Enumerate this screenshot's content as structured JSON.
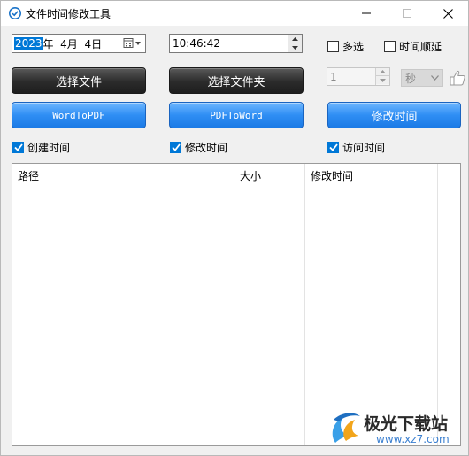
{
  "window": {
    "title": "文件时间修改工具"
  },
  "date": {
    "year": "2023",
    "rest": "年  4月  4日"
  },
  "time": {
    "value": "10:46:42"
  },
  "options": {
    "multi_select_label": "多选",
    "time_order_label": "时间顺延",
    "step_value": "1",
    "unit_value": "秒"
  },
  "buttons": {
    "select_file": "选择文件",
    "select_folder": "选择文件夹",
    "word_to_pdf": "WordToPDF",
    "pdf_to_word": "PDFToWord",
    "modify_time": "修改时间"
  },
  "checks": {
    "created_time": "创建时间",
    "modified_time": "修改时间",
    "accessed_time": "访问时间"
  },
  "list": {
    "columns": [
      "路径",
      "大小",
      "修改时间"
    ],
    "rows": []
  },
  "watermark": {
    "cn": "极光下载站",
    "url": "www.xz7.com"
  },
  "colors": {
    "accent": "#0078d7",
    "button_blue": "#2f8ef4",
    "button_dark": "#2b2b2b"
  }
}
